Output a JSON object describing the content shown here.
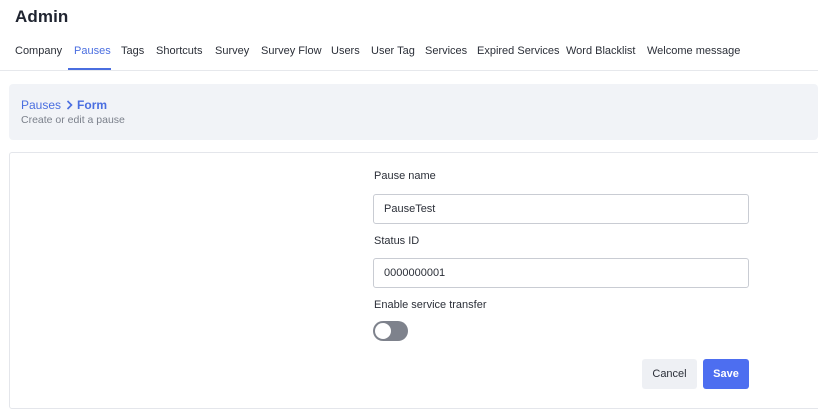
{
  "header": {
    "title": "Admin"
  },
  "tabs": [
    {
      "label": "Company",
      "active": false
    },
    {
      "label": "Pauses",
      "active": true
    },
    {
      "label": "Tags",
      "active": false
    },
    {
      "label": "Shortcuts",
      "active": false
    },
    {
      "label": "Survey",
      "active": false
    },
    {
      "label": "Survey Flow",
      "active": false
    },
    {
      "label": "Users",
      "active": false
    },
    {
      "label": "User Tag",
      "active": false
    },
    {
      "label": "Services",
      "active": false
    },
    {
      "label": "Expired Services",
      "active": false
    },
    {
      "label": "Word Blacklist",
      "active": false
    },
    {
      "label": "Welcome message",
      "active": false
    }
  ],
  "breadcrumb": {
    "parent": "Pauses",
    "separator_icon": "chevron-right-icon",
    "current": "Form",
    "subtitle": "Create or edit a pause"
  },
  "form": {
    "pause_name": {
      "label": "Pause name",
      "value": "PauseTest"
    },
    "status_id": {
      "label": "Status ID",
      "value": "0000000001"
    },
    "service_transfer": {
      "label": "Enable service transfer",
      "enabled": false
    },
    "cancel_label": "Cancel",
    "save_label": "Save"
  },
  "colors": {
    "accent": "#4a6ee0",
    "save_button": "#4d6ef0",
    "toggle_off": "#7e828c",
    "panel_bg": "#f1f3f7"
  }
}
